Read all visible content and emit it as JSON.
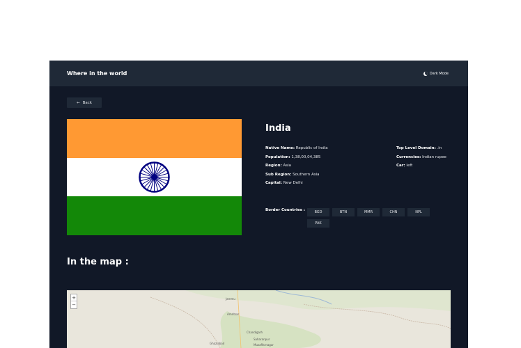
{
  "header": {
    "title": "Where in the world",
    "mode_label": "Dark Mode",
    "mode_icon": "moon-icon"
  },
  "nav": {
    "back_label": "Back",
    "back_icon": "arrow-left-icon"
  },
  "country": {
    "name": "India",
    "native_name_label": "Native Name:",
    "native_name": "Republic of India",
    "population_label": "Population:",
    "population": "1,38,00,04,385",
    "region_label": "Region:",
    "region": "Asia",
    "sub_region_label": "Sub Region:",
    "sub_region": "Southern Asia",
    "capital_label": "Capital:",
    "capital": "New Delhi",
    "tld_label": "Top Level Domain:",
    "tld": ".in",
    "currencies_label": "Currencies:",
    "currencies": "Indian rupee",
    "car_label": "Car:",
    "car": "left",
    "border_label": "Border Countries :",
    "borders": [
      "BGD",
      "BTN",
      "MMR",
      "CHN",
      "NPL",
      "PAK"
    ]
  },
  "map": {
    "title": "In the map :",
    "zoom_in": "+",
    "zoom_out": "−",
    "labels": [
      "Jammu",
      "Amritsar",
      "Chandigarh",
      "Saharanpur",
      "Muzaffarnagar",
      "Ghaziabad"
    ]
  },
  "colors": {
    "background": "#111827",
    "panel": "#1f2937",
    "saffron": "#ff9933",
    "green": "#138808",
    "chakra": "#000080"
  }
}
